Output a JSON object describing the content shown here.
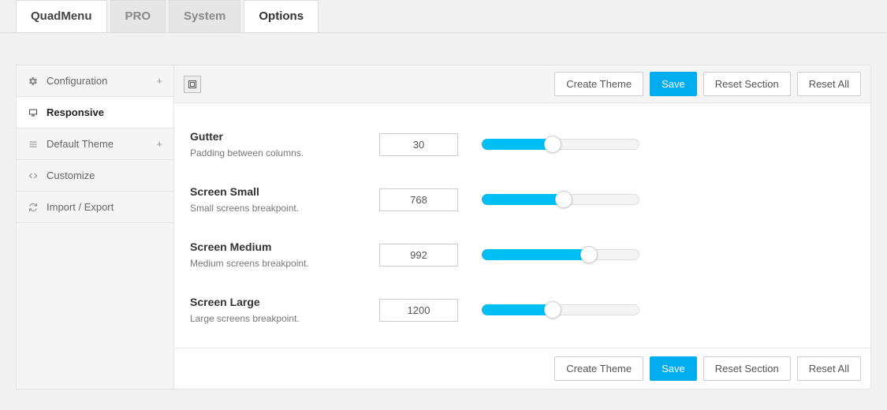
{
  "tabs": {
    "quadmenu": "QuadMenu",
    "pro": "PRO",
    "system": "System",
    "options": "Options"
  },
  "sidebar": {
    "items": [
      {
        "label": "Configuration",
        "expandable": true
      },
      {
        "label": "Responsive",
        "expandable": false
      },
      {
        "label": "Default Theme",
        "expandable": true
      },
      {
        "label": "Customize",
        "expandable": false
      },
      {
        "label": "Import / Export",
        "expandable": false
      }
    ]
  },
  "actions": {
    "create_theme": "Create Theme",
    "save": "Save",
    "reset_section": "Reset Section",
    "reset_all": "Reset All"
  },
  "settings": [
    {
      "title": "Gutter",
      "desc": "Padding between columns.",
      "value": "30",
      "fill": 45
    },
    {
      "title": "Screen Small",
      "desc": "Small screens breakpoint.",
      "value": "768",
      "fill": 52
    },
    {
      "title": "Screen Medium",
      "desc": "Medium screens breakpoint.",
      "value": "992",
      "fill": 68
    },
    {
      "title": "Screen Large",
      "desc": "Large screens breakpoint.",
      "value": "1200",
      "fill": 45
    }
  ]
}
